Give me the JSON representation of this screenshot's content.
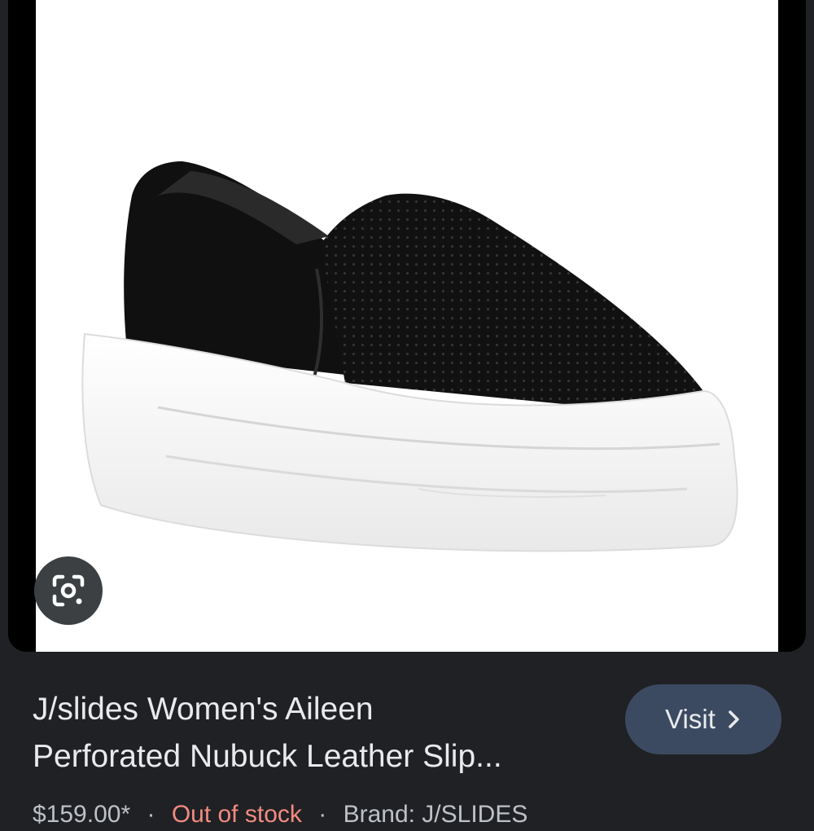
{
  "result": {
    "title_line1": "J/slides Women's Aileen",
    "title_line2": "Perforated Nubuck Leather Slip...",
    "visit_label": "Visit",
    "price": "$159.00*",
    "separator": "·",
    "stock_status": "Out of stock",
    "brand": "Brand:  J/SLIDES"
  },
  "icons": {
    "lens": "google-lens-icon",
    "visit_chevron": "chevron-right-icon"
  },
  "colors": {
    "background": "#202124",
    "visit_button": "#3c4a61",
    "stock_status": "#f28b82",
    "title_text": "#e8eaed"
  }
}
